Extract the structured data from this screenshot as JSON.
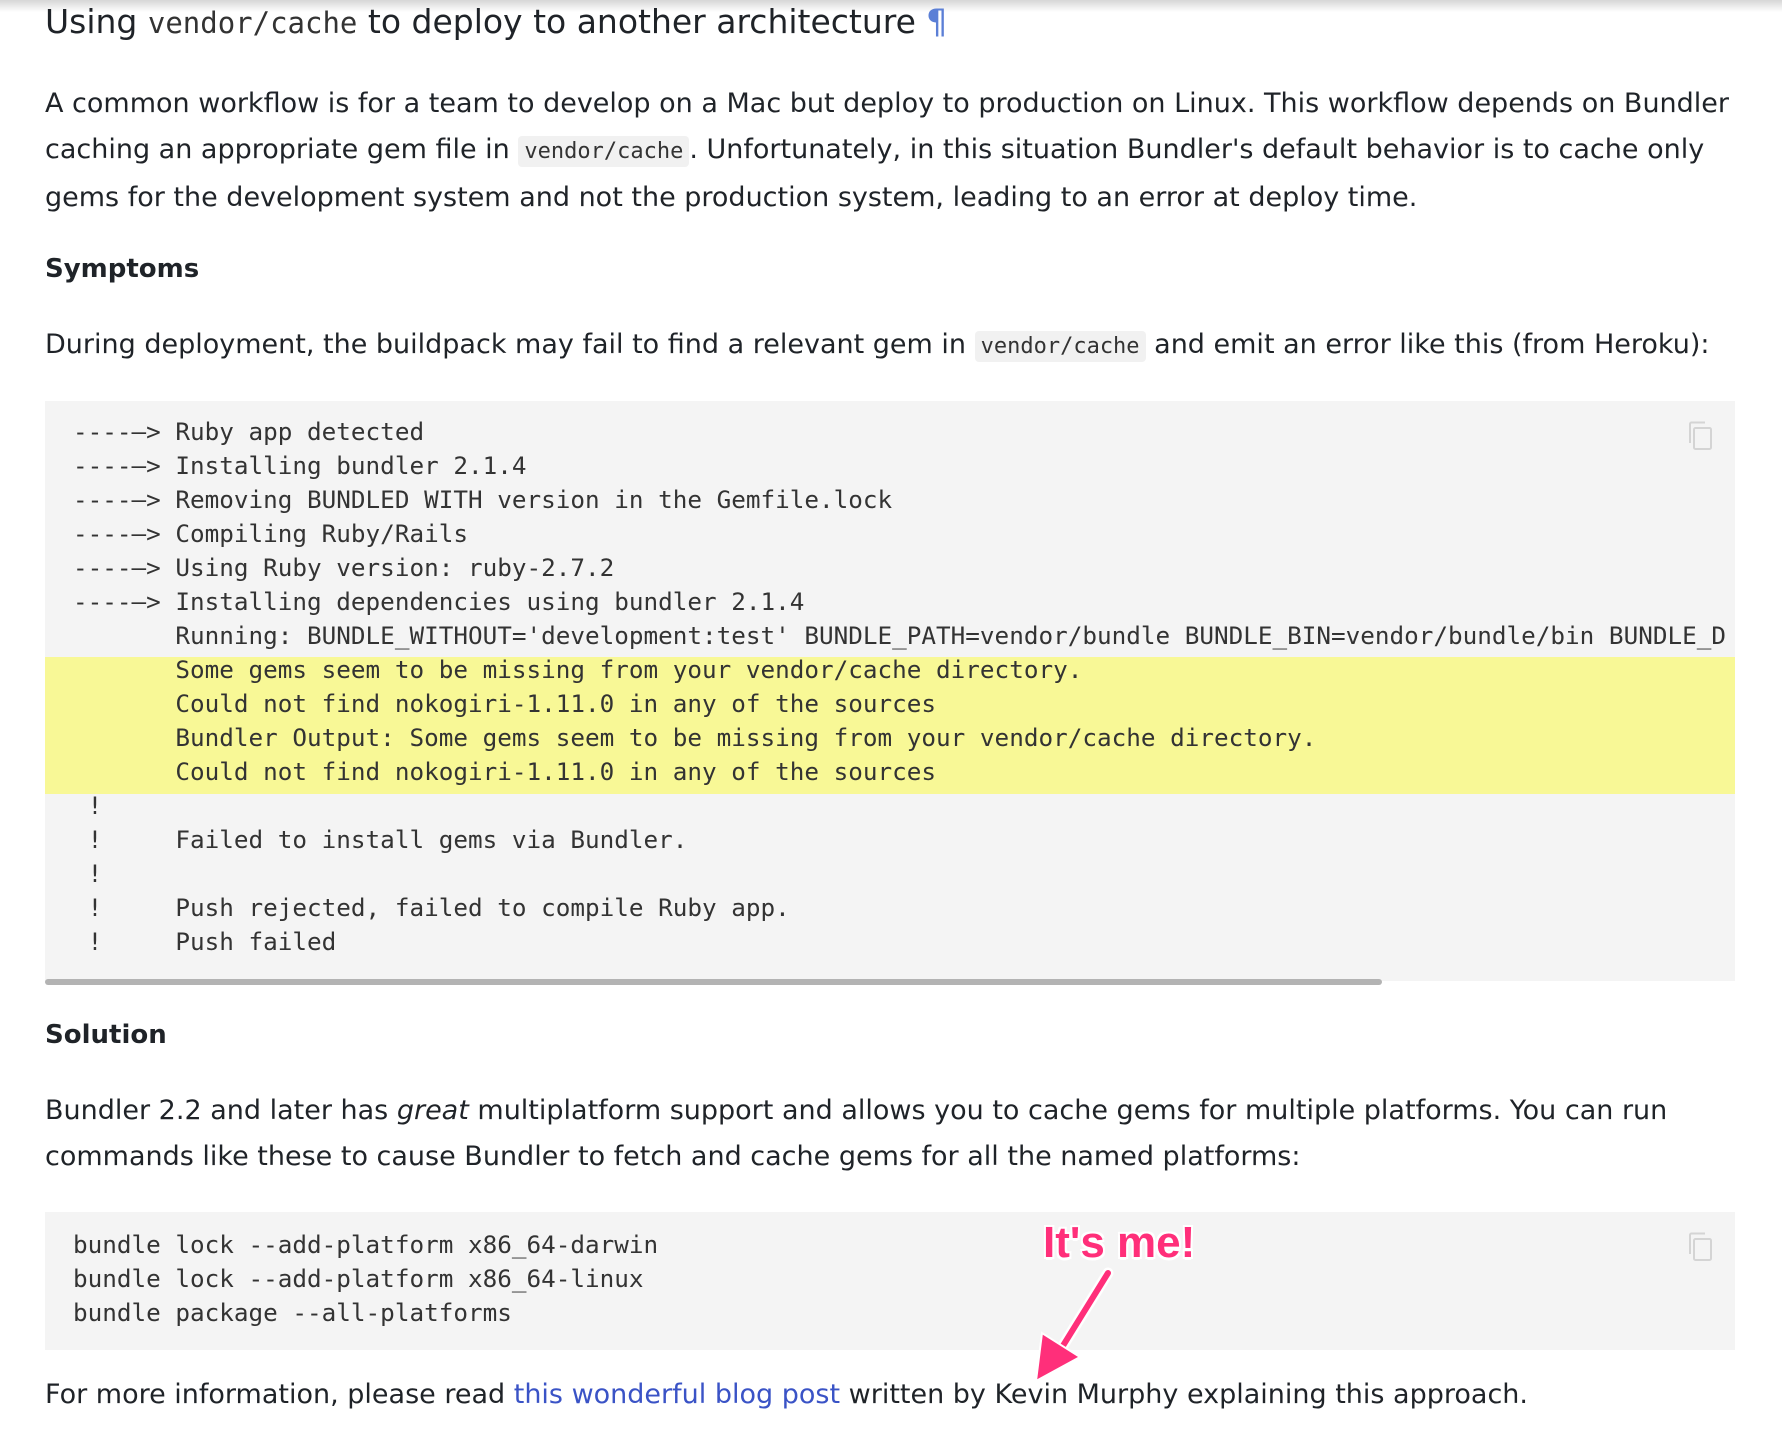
{
  "heading": {
    "prefix": "Using ",
    "code": "vendor/cache",
    "suffix": " to deploy to another architecture",
    "anchor": "¶"
  },
  "intro": {
    "part1": "A common workflow is for a team to develop on a Mac but deploy to production on Linux. This workflow depends on Bundler caching an appropriate gem file in ",
    "code": "vendor/cache",
    "part2": ". Unfortunately, in this situation Bundler's default behavior is to cache only gems for the development system and not the production system, leading to an error at deploy time."
  },
  "symptoms": {
    "title": "Symptoms",
    "part1": "During deployment, the buildpack may fail to find a relevant gem in ",
    "code": "vendor/cache",
    "part2": " and emit an error like this (from Heroku):",
    "lines": [
      "----–> Ruby app detected",
      "----–> Installing bundler 2.1.4",
      "----–> Removing BUNDLED WITH version in the Gemfile.lock",
      "----–> Compiling Ruby/Rails",
      "----–> Using Ruby version: ruby-2.7.2",
      "----–> Installing dependencies using bundler 2.1.4",
      "       Running: BUNDLE_WITHOUT='development:test' BUNDLE_PATH=vendor/bundle BUNDLE_BIN=vendor/bundle/bin BUNDLE_D",
      "       Some gems seem to be missing from your vendor/cache directory.",
      "       Could not find nokogiri-1.11.0 in any of the sources",
      "       Bundler Output: Some gems seem to be missing from your vendor/cache directory.",
      "       Could not find nokogiri-1.11.0 in any of the sources",
      " !",
      " !     Failed to install gems via Bundler.",
      " !",
      " !     Push rejected, failed to compile Ruby app.",
      " !     Push failed"
    ]
  },
  "solution": {
    "title": "Solution",
    "part1": "Bundler 2.2 and later has ",
    "emphasis": "great",
    "part2": " multiplatform support and allows you to cache gems for multiple platforms. You can run commands like these to cause Bundler to fetch and cache gems for all the named platforms:",
    "lines": [
      "bundle lock --add-platform x86_64-darwin",
      "bundle lock --add-platform x86_64-linux",
      "bundle package --all-platforms"
    ]
  },
  "footer": {
    "part1": "For more information, please read ",
    "link": "this wonderful blog post",
    "part2": " written by Kevin Murphy explaining this approach."
  },
  "annotation": {
    "text": "It's me!",
    "color": "#ff2f7a"
  },
  "colors": {
    "highlight": "#f8f896",
    "link": "#3a53c6",
    "code_bg": "#f4f4f4"
  }
}
